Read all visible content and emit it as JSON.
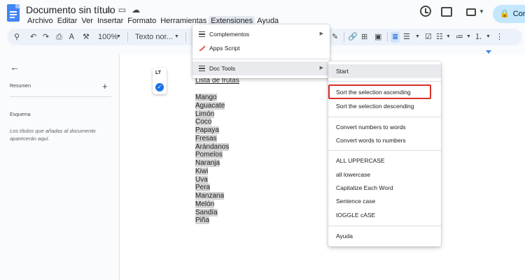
{
  "app": {
    "title": "Documento sin título",
    "share_label": "Comp"
  },
  "menubar": [
    "Archivo",
    "Editar",
    "Ver",
    "Insertar",
    "Formato",
    "Herramientas",
    "Extensiones",
    "Ayuda"
  ],
  "toolbar": {
    "zoom": "100%",
    "style": "Texto nor..."
  },
  "sidebar": {
    "resumen": "Resumen",
    "esquema": "Esquema",
    "hint": "Los títulos que añadas al documento aparecerán aquí."
  },
  "lt_widget": {
    "logo": "LT"
  },
  "document": {
    "heading": "Lista de frutas",
    "fruits": [
      "Mango",
      "Aguacate",
      "Limón",
      "Coco",
      "Papaya",
      "Fresas",
      "Arándanos",
      "Pomelos",
      "Naranja",
      "Kiwi",
      "Uva",
      "Pera",
      "Manzana",
      "Melón",
      "Sandía",
      "Piña"
    ]
  },
  "extensions_menu": {
    "complementos": "Complementos",
    "apps_script": "Apps Script",
    "doc_tools": "Doc Tools"
  },
  "doc_tools_menu": {
    "start": "Start",
    "sort_asc": "Sort the selection ascending",
    "sort_desc": "Sort the selection descending",
    "num_to_words": "Convert numbers to words",
    "words_to_num": "Convert words to numbers",
    "upper": "ALL UPPERCASE",
    "lower": "all lowercase",
    "capitalize": "Capitalize Each Word",
    "sentence": "Sentence case",
    "toggle": "tOGGLE cASE",
    "ayuda": "Ayuda"
  },
  "colors": {
    "accent": "#0b57d0",
    "highlight_box": "#d93025",
    "selection": "#d3d3d3"
  }
}
